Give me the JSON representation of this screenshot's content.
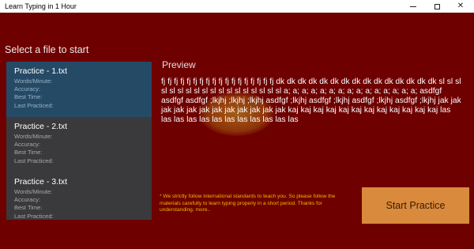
{
  "window": {
    "title": "Learn Typing in 1 Hour",
    "minimize_glyph": "—",
    "maximize_glyph": "☐",
    "close_glyph": "✕"
  },
  "left": {
    "select_label": "Select a file to start",
    "files": [
      {
        "name": "Practice - 1.txt",
        "wpm_label": "Words/Minute:",
        "accuracy_label": "Accuracy:",
        "best_time_label": "Best Time:",
        "last_practiced_label": "Last Practiced:"
      },
      {
        "name": "Practice - 2.txt",
        "wpm_label": "Words/Minute:",
        "accuracy_label": "Accuracy:",
        "best_time_label": "Best Time:",
        "last_practiced_label": "Last Practiced:"
      },
      {
        "name": "Practice - 3.txt",
        "wpm_label": "Words/Minute:",
        "accuracy_label": "Accuracy:",
        "best_time_label": "Best Time:",
        "last_practiced_label": "Last Practiced:"
      }
    ]
  },
  "preview": {
    "label": "Preview",
    "text": "fj fj fj fj fj fj fj fj fj fj fj fj fj fj fj fj fj fj dk dk dk dk dk dk dk dk dk dk dk dk dk dk dk sl sl sl sl sl sl sl sl sl sl sl sl sl sl sl sl sl sl a; a; a; a; a; a; a; a; a; a; a; a; a; a; a; asdfgf asdfgf asdfgf ;lkjhj ;lkjhj ;lkjhj asdfgf ;lkjhj asdfgf ;lkjhj asdfgf ;lkjhj asdfgf ;lkjhj jak jak jak jak jak jak jak jak jak jak jak jak kaj kaj kaj kaj kaj kaj kaj kaj kaj kaj kaj kaj las las las las las las las las las las las las"
  },
  "notice": "* We strictly follow international standards to teach you. So please follow the materials carefully to learn typing properly in a short period. Thanks for understanding. more..",
  "actions": {
    "start_label": "Start Practice"
  },
  "colors": {
    "background": "#6e0000",
    "selected_item": "#254a66",
    "start_button": "#d98a3c",
    "notice_text": "#f2b800"
  }
}
